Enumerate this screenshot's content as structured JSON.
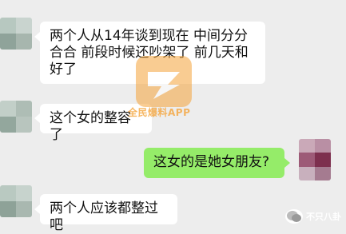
{
  "chat": {
    "messages": [
      {
        "side": "left",
        "text": "两个人从14年谈到现在 中间分分合合 前段时候还吵架了 前几天和好了"
      },
      {
        "side": "left",
        "text": "这个女的整容了"
      },
      {
        "side": "right",
        "text": "这女的是她女朋友?"
      },
      {
        "side": "left",
        "text": "两个人应该都整过吧"
      }
    ]
  },
  "watermark": {
    "text": "全民爆料APP"
  },
  "source": {
    "label": "不只八卦"
  },
  "colors": {
    "background": "#ededed",
    "left_bubble": "#ffffff",
    "right_bubble": "#95ec69",
    "watermark": "#f5a43a"
  }
}
